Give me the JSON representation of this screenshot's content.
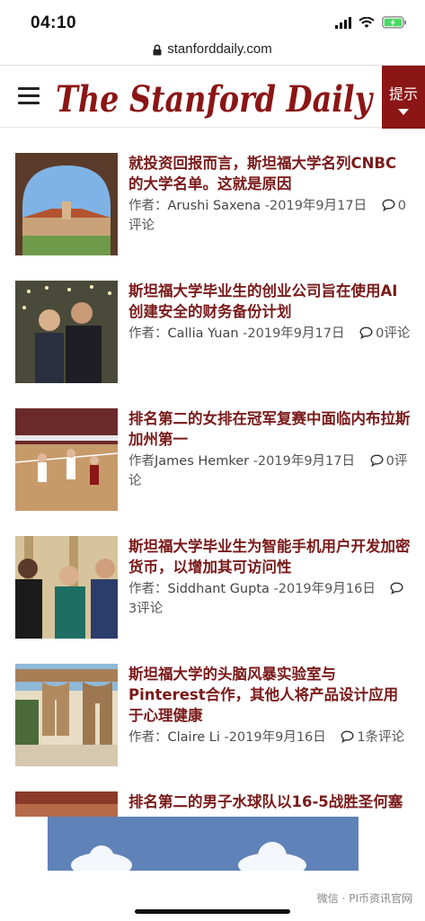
{
  "status": {
    "time": "04:10"
  },
  "browser": {
    "url": "stanforddaily.com"
  },
  "header": {
    "title": "The Stanford Daily",
    "hint_label": "提示"
  },
  "articles": [
    {
      "headline": "就投资回报而言，斯坦福大学名列CNBC的大学名单。这就是原因",
      "author_prefix": "作者：",
      "author": "Arushi Saxena",
      "date": " -2019年9月17日",
      "comments": "0评论"
    },
    {
      "headline": "斯坦福大学毕业生的创业公司旨在使用AI创建安全的财务备份计划",
      "author_prefix": "作者：",
      "author": "Callia Yuan",
      "date": " -2019年9月17日",
      "comments": "0评论"
    },
    {
      "headline": "排名第二的女排在冠军复赛中面临内布拉斯加州第一",
      "author_prefix": "作者",
      "author": "James Hemker",
      "date": " -2019年9月17日",
      "comments": "0评论"
    },
    {
      "headline": "斯坦福大学毕业生为智能手机用户开发加密货币，以增加其可访问性",
      "author_prefix": "作者：",
      "author": "Siddhant Gupta",
      "date": " -2019年9月16日",
      "comments": "3评论"
    },
    {
      "headline": "斯坦福大学的头脑风暴实验室与Pinterest合作，其他人将产品设计应用于心理健康",
      "author_prefix": "作者：",
      "author": "Claire Li",
      "date": " -2019年9月16日",
      "comments": "1条评论"
    },
    {
      "headline": "排名第二的男子水球队以16-5战胜圣何塞",
      "author_prefix": "",
      "author": "",
      "date": "",
      "comments": ""
    }
  ],
  "watermark": "微信 · PI币资讯官网"
}
